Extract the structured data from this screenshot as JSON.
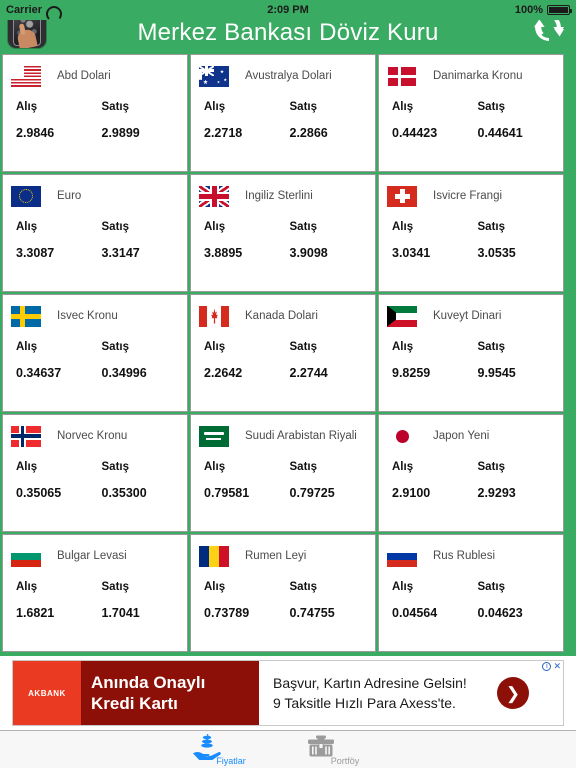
{
  "status_bar": {
    "carrier": "Carrier",
    "wifi_icon": "wifi-icon",
    "time": "2:09 PM",
    "battery_percent": "100%",
    "battery_icon": "battery-full-icon"
  },
  "navbar": {
    "title": "Merkez Bankası Döviz Kuru",
    "app_icon": "app-icon",
    "refresh_icon": "refresh-icon",
    "background": "#3aab62"
  },
  "labels": {
    "buy": "Alış",
    "sell": "Satış"
  },
  "currencies": [
    {
      "name": "Abd Dolari",
      "flag": "f-us",
      "flag_icon": "flag-us-icon",
      "buy": "2.9846",
      "sell": "2.9899"
    },
    {
      "name": "Avustralya Dolari",
      "flag": "f-au",
      "flag_icon": "flag-au-icon",
      "buy": "2.2718",
      "sell": "2.2866"
    },
    {
      "name": "Danimarka Kronu",
      "flag": "f-dk",
      "flag_icon": "flag-dk-icon",
      "buy": "0.44423",
      "sell": "0.44641"
    },
    {
      "name": "Euro",
      "flag": "f-eu",
      "flag_icon": "flag-eu-icon",
      "buy": "3.3087",
      "sell": "3.3147"
    },
    {
      "name": "Ingiliz Sterlini",
      "flag": "f-gb",
      "flag_icon": "flag-gb-icon",
      "buy": "3.8895",
      "sell": "3.9098"
    },
    {
      "name": "Isvicre Frangi",
      "flag": "f-ch",
      "flag_icon": "flag-ch-icon",
      "buy": "3.0341",
      "sell": "3.0535"
    },
    {
      "name": "Isvec Kronu",
      "flag": "f-se",
      "flag_icon": "flag-se-icon",
      "buy": "0.34637",
      "sell": "0.34996"
    },
    {
      "name": "Kanada Dolari",
      "flag": "f-ca",
      "flag_icon": "flag-ca-icon",
      "buy": "2.2642",
      "sell": "2.2744"
    },
    {
      "name": "Kuveyt Dinari",
      "flag": "f-kw",
      "flag_icon": "flag-kw-icon",
      "buy": "9.8259",
      "sell": "9.9545"
    },
    {
      "name": "Norvec Kronu",
      "flag": "f-no",
      "flag_icon": "flag-no-icon",
      "buy": "0.35065",
      "sell": "0.35300"
    },
    {
      "name": "Suudi Arabistan Riyali",
      "flag": "f-sa",
      "flag_icon": "flag-sa-icon",
      "buy": "0.79581",
      "sell": "0.79725"
    },
    {
      "name": "Japon Yeni",
      "flag": "f-jp",
      "flag_icon": "flag-jp-icon",
      "buy": "2.9100",
      "sell": "2.9293"
    },
    {
      "name": "Bulgar Levasi",
      "flag": "f-bg",
      "flag_icon": "flag-bg-icon",
      "buy": "1.6821",
      "sell": "1.7041"
    },
    {
      "name": "Rumen Leyi",
      "flag": "f-ro",
      "flag_icon": "flag-ro-icon",
      "buy": "0.73789",
      "sell": "0.74755"
    },
    {
      "name": "Rus Rublesi",
      "flag": "f-ru",
      "flag_icon": "flag-ru-icon",
      "buy": "0.04564",
      "sell": "0.04623"
    }
  ],
  "ad": {
    "advertiser": "AKBANK",
    "headline": "Anında Onaylı Kredi Kartı",
    "line1": "Başvur, Kartın Adresine Gelsin!",
    "line2": "9 Taksitle Hızlı Para Axess'te.",
    "cta_icon": "chevron-right-icon",
    "info_icon": "ad-info-icon",
    "close_icon": "close-icon",
    "logo_background": "#ea3b22",
    "headline_background": "#8c1007"
  },
  "tabbar": {
    "tabs": [
      {
        "label": "Fiyatlar",
        "icon": "hand-coins-icon",
        "active": true
      },
      {
        "label": "Portföy",
        "icon": "briefcase-icon",
        "active": false
      }
    ],
    "active_color": "#1a8cff",
    "inactive_color": "#9b9b9b"
  }
}
